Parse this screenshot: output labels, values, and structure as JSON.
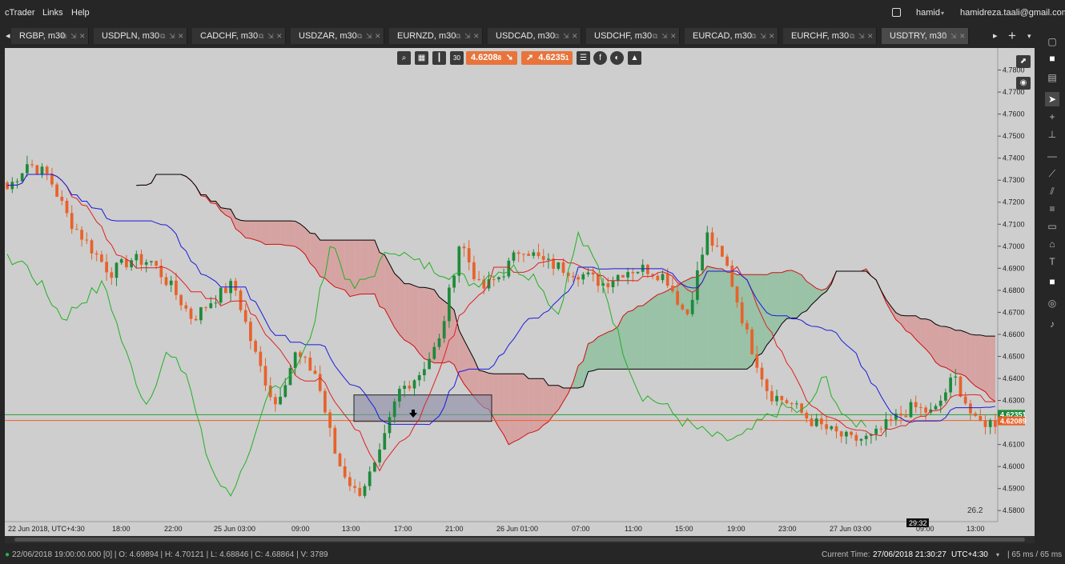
{
  "app": {
    "menu": [
      "cTrader",
      "Links",
      "Help"
    ],
    "user": "hamid",
    "email": "hamidreza.taali@gmail.com"
  },
  "tabs": [
    {
      "label": "RGBP, m30",
      "active": false
    },
    {
      "label": "USDPLN, m30",
      "active": false
    },
    {
      "label": "CADCHF, m30",
      "active": false
    },
    {
      "label": "USDZAR, m30",
      "active": false
    },
    {
      "label": "EURNZD, m30",
      "active": false
    },
    {
      "label": "USDCAD, m30",
      "active": false
    },
    {
      "label": "USDCHF, m30",
      "active": false
    },
    {
      "label": "EURCAD, m30",
      "active": false
    },
    {
      "label": "EURCHF, m30",
      "active": false
    },
    {
      "label": "USDTRY, m30",
      "active": true
    }
  ],
  "tab_icons": [
    "popout-icon",
    "detach-icon",
    "close-icon"
  ],
  "toolbar": {
    "timeframe": "30",
    "sell_price": "4.6208",
    "sell_price_sup": "8",
    "buy_price": "4.6235",
    "buy_price_sup": "1"
  },
  "chart_data": {
    "type": "candlestick",
    "symbol": "USDTRY",
    "timeframe": "m30",
    "y_axis": {
      "ylim": [
        4.575,
        4.79
      ],
      "ticks": [
        "4.7800",
        "4.7700",
        "4.7600",
        "4.7500",
        "4.7400",
        "4.7300",
        "4.7200",
        "4.7100",
        "4.7000",
        "4.6900",
        "4.6800",
        "4.6700",
        "4.6600",
        "4.6500",
        "4.6400",
        "4.6300",
        "4.6200",
        "4.6100",
        "4.6000",
        "4.5900",
        "4.5800"
      ]
    },
    "x_axis": {
      "ticks": [
        "22 Jun 2018, UTC+4:30",
        "18:00",
        "22:00",
        "25 Jun 03:00",
        "09:00",
        "13:00",
        "17:00",
        "21:00",
        "26 Jun 01:00",
        "07:00",
        "11:00",
        "15:00",
        "19:00",
        "23:00",
        "27 Jun 03:00",
        "09:00",
        "13:00"
      ]
    },
    "current_ask": "4.62351",
    "current_bid": "4.62089",
    "countdown": "29:32",
    "corner_value": "26.2",
    "close_anchors": [
      4.726,
      4.738,
      4.732,
      4.712,
      4.7,
      4.688,
      4.694,
      4.693,
      4.681,
      4.667,
      4.676,
      4.683,
      4.652,
      4.628,
      4.651,
      4.642,
      4.603,
      4.587,
      4.602,
      4.634,
      4.642,
      4.657,
      4.703,
      4.68,
      4.687,
      4.7,
      4.693,
      4.69,
      4.687,
      4.683,
      4.689,
      4.69,
      4.686,
      4.668,
      4.705,
      4.69,
      4.658,
      4.633,
      4.629,
      4.621,
      4.616,
      4.612,
      4.613,
      4.621,
      4.627,
      4.624,
      4.641,
      4.62,
      4.62
    ],
    "indicators": [
      "Ichimoku Tenkan-sen",
      "Ichimoku Kijun-sen",
      "Ichimoku Senkou Span A",
      "Ichimoku Senkou Span B",
      "Ichimoku Chikou Span"
    ]
  },
  "status": {
    "ohlc": "22/06/2018 19:00:00.000 [0] | O: 4.69894 | H: 4.70121 | L: 4.68846 | C: 4.68864 | V: 3789",
    "current_time_label": "Current Time:",
    "current_time": "27/06/2018 21:30:27",
    "timezone": "UTC+4:30",
    "latency": "| 65 ms / 65 ms"
  },
  "colors": {
    "bull": "#1e8a3a",
    "bear": "#e8622a",
    "tenkan": "#e02020",
    "kijun": "#1a1ae0",
    "chikou": "#22b022",
    "cloud_bull": "#8fbfa0",
    "cloud_bear": "#d79b9b",
    "background": "#cecece"
  }
}
